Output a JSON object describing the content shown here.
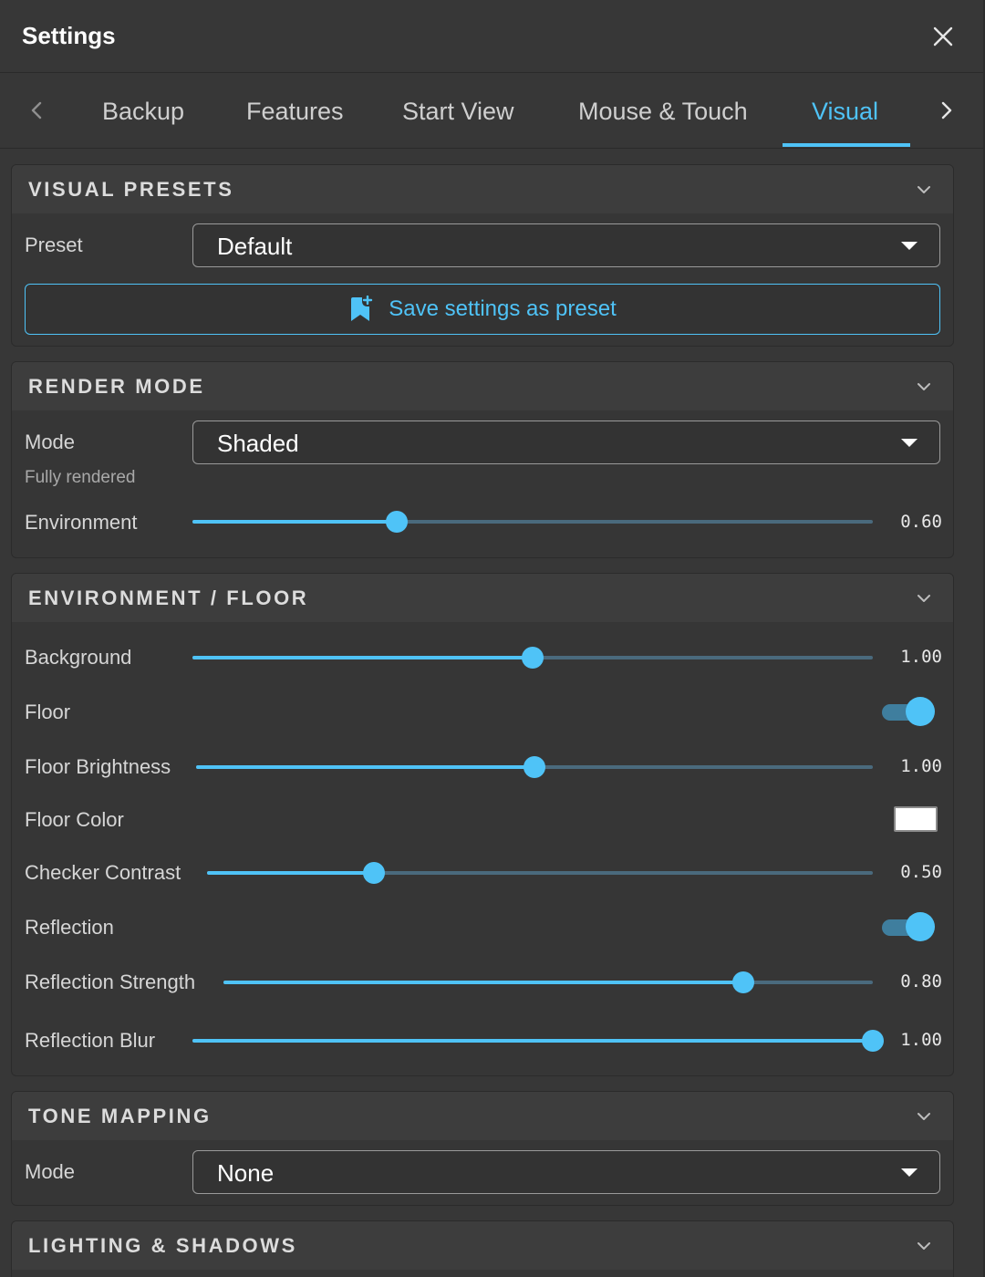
{
  "window": {
    "title": "Settings"
  },
  "tabs": [
    {
      "label": "Backup"
    },
    {
      "label": "Features"
    },
    {
      "label": "Start View"
    },
    {
      "label": "Mouse & Touch"
    },
    {
      "label": "Visual",
      "active": true
    }
  ],
  "accent_color": "#4fc3f7",
  "icons": {
    "close": "close-icon",
    "tab_prev": "chevron-left-icon",
    "tab_next": "chevron-right-icon",
    "collapse": "chevron-down-icon",
    "save_preset": "bookmark-add-icon"
  },
  "visual_presets": {
    "title": "VISUAL PRESETS",
    "preset_label": "Preset",
    "preset_value": "Default",
    "save_button": "Save settings as preset"
  },
  "render_mode": {
    "title": "RENDER MODE",
    "mode_label": "Mode",
    "mode_value": "Shaded",
    "mode_hint": "Fully rendered",
    "environment_label": "Environment",
    "environment_value": "0.60",
    "environment_level": 0.3
  },
  "environment_floor": {
    "title": "ENVIRONMENT / FLOOR",
    "background_label": "Background",
    "background_value": "1.00",
    "background_level": 0.5,
    "floor_label": "Floor",
    "floor_on": true,
    "floor_brightness_label": "Floor Brightness",
    "floor_brightness_value": "1.00",
    "floor_brightness_level": 0.5,
    "floor_color_label": "Floor Color",
    "floor_color": "#ffffff",
    "checker_contrast_label": "Checker Contrast",
    "checker_contrast_value": "0.50",
    "checker_contrast_level": 0.25,
    "reflection_label": "Reflection",
    "reflection_on": true,
    "reflection_strength_label": "Reflection Strength",
    "reflection_strength_value": "0.80",
    "reflection_strength_level": 0.8,
    "reflection_blur_label": "Reflection Blur",
    "reflection_blur_value": "1.00",
    "reflection_blur_level": 1.0
  },
  "tone_mapping": {
    "title": "TONE MAPPING",
    "mode_label": "Mode",
    "mode_value": "None"
  },
  "lighting_shadows": {
    "title": "LIGHTING & SHADOWS"
  }
}
